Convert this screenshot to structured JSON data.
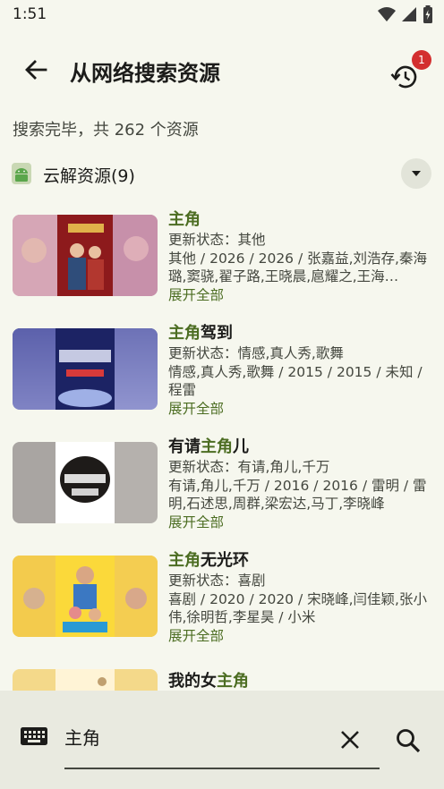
{
  "status": {
    "time": "1:51"
  },
  "appbar": {
    "title": "从网络搜索资源",
    "history_badge": "1"
  },
  "summary": "搜索完毕，共 262 个资源",
  "group": {
    "label": "云解资源(9)"
  },
  "results": [
    {
      "title_hl_pre": "",
      "title_hl": "主角",
      "title_post": "",
      "status": "更新状态：其他",
      "desc": "其他 / 2026 / 2026 / 张嘉益,刘浩存,秦海璐,窦骁,翟子路,王晓晨,扈耀之,王海…",
      "more": "展开全部"
    },
    {
      "title_hl_pre": "",
      "title_hl": "主角",
      "title_post": "驾到",
      "status": "更新状态：情感,真人秀,歌舞",
      "desc": "情感,真人秀,歌舞 / 2015 / 2015 / 未知 / 程雷",
      "more": "展开全部"
    },
    {
      "title_hl_pre": "有请",
      "title_hl": "主角",
      "title_post": "儿",
      "status": "更新状态：有请,角儿,千万",
      "desc": "有请,角儿,千万 / 2016 / 2016 / 雷明 / 雷明,石述思,周群,梁宏达,马丁,李晓峰",
      "more": "展开全部"
    },
    {
      "title_hl_pre": "",
      "title_hl": "主角",
      "title_post": "无光环",
      "status": "更新状态：喜剧",
      "desc": "喜剧 / 2020 / 2020 / 宋晓峰,闫佳颖,张小伟,徐明哲,李星昊 / 小米",
      "more": "展开全部"
    },
    {
      "title_hl_pre": "我的女",
      "title_hl": "主角",
      "title_post": "",
      "status": "",
      "desc": "",
      "more": ""
    }
  ],
  "search": {
    "value": "主角"
  },
  "colors": {
    "background": "#f6f7ee",
    "highlight": "#4c6d22",
    "badge": "#d32f2f",
    "bottom_bar": "#e9eae0"
  }
}
